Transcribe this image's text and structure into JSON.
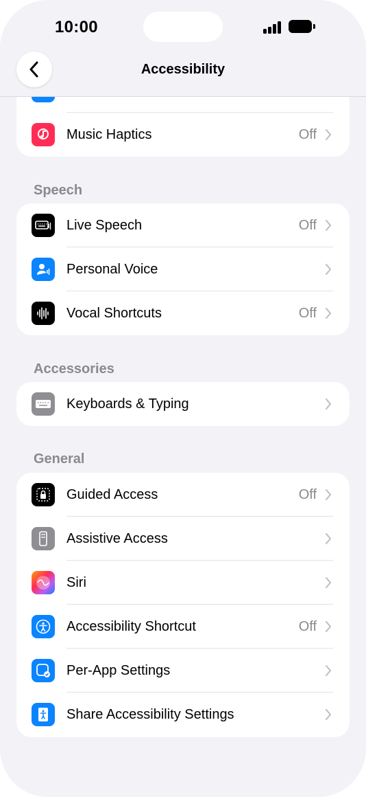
{
  "status": {
    "time": "10:00"
  },
  "nav": {
    "title": "Accessibility"
  },
  "top_group": {
    "rows": [
      {
        "label": "Music Haptics",
        "value": "Off",
        "icon": "music-haptics-icon",
        "color": "#ff2d55"
      }
    ]
  },
  "speech": {
    "header": "Speech",
    "rows": [
      {
        "label": "Live Speech",
        "value": "Off",
        "icon": "keyboard-waveform-icon",
        "color": "#000000"
      },
      {
        "label": "Personal Voice",
        "value": "",
        "icon": "person-waveform-icon",
        "color": "#0a84ff"
      },
      {
        "label": "Vocal Shortcuts",
        "value": "Off",
        "icon": "waveform-icon",
        "color": "#000000"
      }
    ]
  },
  "accessories": {
    "header": "Accessories",
    "rows": [
      {
        "label": "Keyboards & Typing",
        "value": "",
        "icon": "keyboard-icon",
        "color": "#8e8e93"
      }
    ]
  },
  "general": {
    "header": "General",
    "rows": [
      {
        "label": "Guided Access",
        "value": "Off",
        "icon": "guided-access-lock-icon",
        "color": "#000000"
      },
      {
        "label": "Assistive Access",
        "value": "",
        "icon": "assistive-access-icon",
        "color": "#8e8e93"
      },
      {
        "label": "Siri",
        "value": "",
        "icon": "siri-icon",
        "color": "#5e5ce6"
      },
      {
        "label": "Accessibility Shortcut",
        "value": "Off",
        "icon": "accessibility-person-icon",
        "color": "#0a84ff"
      },
      {
        "label": "Per-App Settings",
        "value": "",
        "icon": "per-app-settings-icon",
        "color": "#0a84ff"
      },
      {
        "label": "Share Accessibility Settings",
        "value": "",
        "icon": "share-person-icon",
        "color": "#0a84ff"
      }
    ]
  }
}
